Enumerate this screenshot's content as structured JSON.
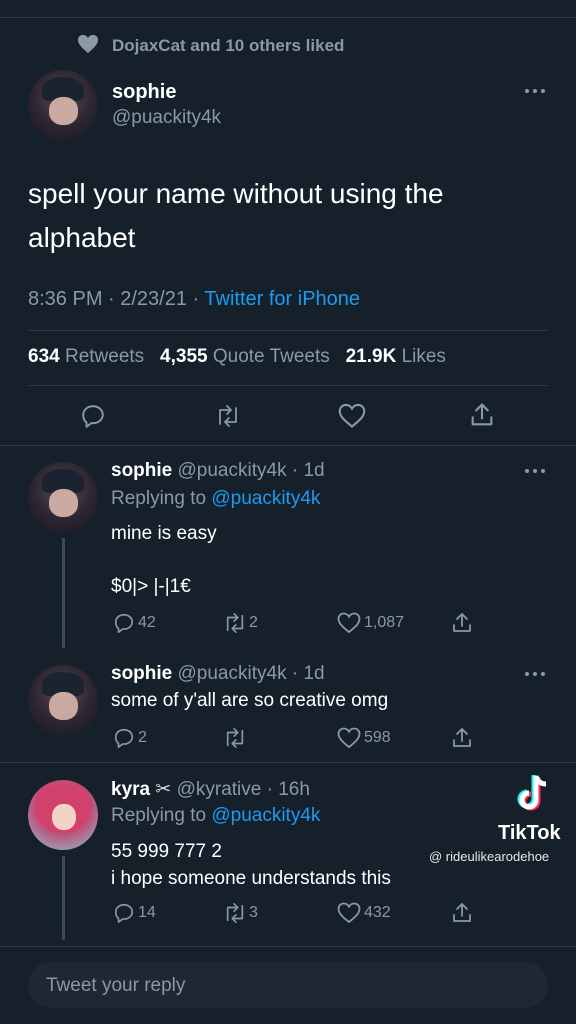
{
  "liked_by": "DojaxCat and 10 others liked",
  "tweet": {
    "name": "sophie",
    "handle": "@puackity4k",
    "text_line1": "spell your name without using the",
    "text_line2": "alphabet",
    "datetime": "8:36 PM · 2/23/21 · ",
    "source": "Twitter for iPhone",
    "retweets_count": "634",
    "retweets_label": "Retweets",
    "quotes_count": "4,355",
    "quotes_label": "Quote Tweets",
    "likes_count": "21.9K",
    "likes_label": "Likes"
  },
  "replies": [
    {
      "name": "sophie",
      "meta": "@puackity4k · 1d",
      "replying_prefix": "Replying to ",
      "replying_to": "@puackity4k",
      "line1": "mine is easy",
      "line2": "$0|> |-|1€",
      "reply_count": "42",
      "retweet_count": "2",
      "like_count": "1,087"
    },
    {
      "name": "sophie",
      "meta": "@puackity4k · 1d",
      "line1": "some of y'all are so creative omg",
      "reply_count": "2",
      "retweet_count": "",
      "like_count": "598"
    },
    {
      "name": "kyra",
      "name_emoji": "✂",
      "meta": "@kyrative · 16h",
      "replying_prefix": "Replying to ",
      "replying_to": "@puackity4k",
      "line1": "55 999 777 2",
      "line2": "i hope someone understands this",
      "reply_count": "14",
      "retweet_count": "3",
      "like_count": "432"
    }
  ],
  "watermark": {
    "brand": "TikTok",
    "handle": "@ rideulikearodehoe"
  },
  "compose_placeholder": "Tweet your reply",
  "colors": {
    "background": "#15202b",
    "accent": "#1d9bf0",
    "muted": "#8b98a5"
  }
}
